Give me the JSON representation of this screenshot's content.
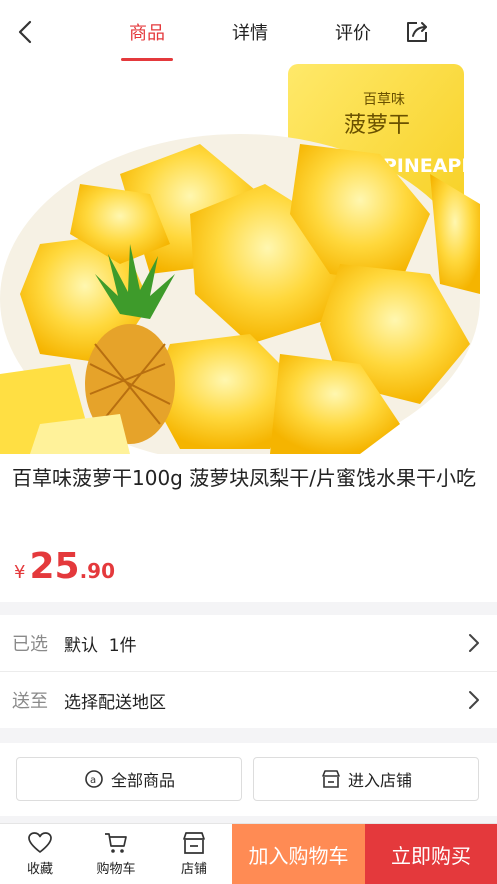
{
  "nav": {
    "tabs": [
      {
        "label": "商品",
        "active": true
      },
      {
        "label": "详情",
        "active": false
      },
      {
        "label": "评价",
        "active": false
      }
    ],
    "back_icon": "chevron-left-icon",
    "share_icon": "share-icon"
  },
  "hero": {
    "package_brand": "百草味",
    "package_title": "菠萝干",
    "package_english": "DRIED PINEAPPLE"
  },
  "product": {
    "title": "百草味菠萝干100g 菠萝块凤梨干/片蜜饯水果干小吃",
    "price_symbol": "¥",
    "price_int": "25",
    "price_dec": ".90"
  },
  "rows": [
    {
      "label": "已选",
      "value": "默认  1件"
    },
    {
      "label": "送至",
      "value": "选择配送地区"
    }
  ],
  "shop": {
    "all_products": "全部商品",
    "enter_store": "进入店铺"
  },
  "bottom": {
    "favorite": "收藏",
    "cart": "购物车",
    "store": "店铺",
    "add_to_cart": "加入购物车",
    "buy_now": "立即购买"
  },
  "colors": {
    "accent": "#e4393c",
    "cart_button": "#ff8b54"
  }
}
